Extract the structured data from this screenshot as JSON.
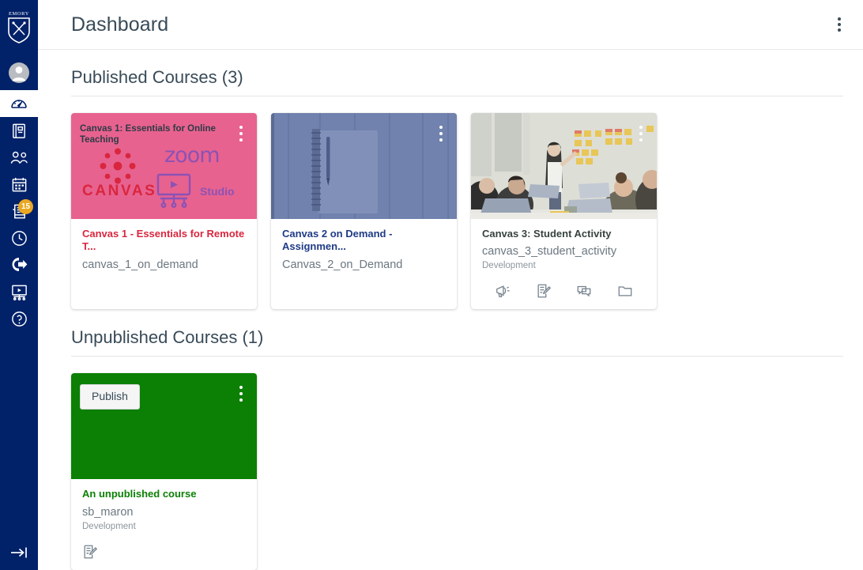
{
  "sidebar": {
    "brand": {
      "name": "EMORY",
      "logo_icon": "emory-shield-logo"
    },
    "items": [
      {
        "key": "account",
        "label": "Account",
        "icon": "user-avatar-icon",
        "active": false,
        "badge": null
      },
      {
        "key": "dashboard",
        "label": "Dashboard",
        "icon": "dashboard-gauge-icon",
        "active": true,
        "badge": null
      },
      {
        "key": "courses",
        "label": "Courses",
        "icon": "book-icon",
        "active": false,
        "badge": null
      },
      {
        "key": "groups",
        "label": "Groups",
        "icon": "people-group-icon",
        "active": false,
        "badge": null
      },
      {
        "key": "calendar",
        "label": "Calendar",
        "icon": "calendar-icon",
        "active": false,
        "badge": null
      },
      {
        "key": "inbox",
        "label": "Inbox",
        "icon": "inbox-tray-icon",
        "active": false,
        "badge": "15"
      },
      {
        "key": "history",
        "label": "History",
        "icon": "clock-icon",
        "active": false,
        "badge": null
      },
      {
        "key": "commons",
        "label": "Commons",
        "icon": "arrow-exit-icon",
        "active": false,
        "badge": null
      },
      {
        "key": "studio",
        "label": "Studio",
        "icon": "studio-screen-icon",
        "active": false,
        "badge": null
      },
      {
        "key": "help",
        "label": "Help",
        "icon": "question-circle-icon",
        "active": false,
        "badge": null
      }
    ],
    "collapse": {
      "label": "Expand navigation",
      "icon": "arrow-to-line-right-icon"
    },
    "background_color": "#012169",
    "badge_color": "#eaa721"
  },
  "header": {
    "title": "Dashboard",
    "options_menu": {
      "label": "Dashboard Options",
      "icon": "kebab-menu-icon"
    }
  },
  "published_section": {
    "title": "Published Courses (3)",
    "count": 3,
    "cards": [
      {
        "id": "canvas-1",
        "title": "Canvas 1 - Essentials for Remote T...",
        "code": "canvas_1_on_demand",
        "term": "",
        "color": "#e8628f",
        "title_color": "#d9263f",
        "kind": "graphic",
        "tile_heading": "Canvas 1: Essentials for Online Teaching",
        "tile_logos": [
          "CANVAS",
          "zoom",
          "Studio"
        ],
        "menu": {
          "label": "Canvas 1 options",
          "icon": "kebab-menu-icon"
        },
        "actions": []
      },
      {
        "id": "canvas-2",
        "title": "Canvas 2 on Demand - Assignmen...",
        "code": "Canvas_2_on_Demand",
        "term": "",
        "color": "#6d7fab",
        "title_color": "#1f3b87",
        "kind": "photo-notebook",
        "menu": {
          "label": "Canvas 2 options",
          "icon": "kebab-menu-icon"
        },
        "actions": []
      },
      {
        "id": "canvas-3",
        "title": "Canvas 3: Student Activity",
        "code": "canvas_3_student_activity",
        "term": "Development",
        "color": "#cfcfc6",
        "title_color": "#37433d",
        "kind": "photo-classroom",
        "menu": {
          "label": "Canvas 3 options",
          "icon": "kebab-menu-icon"
        },
        "actions": [
          {
            "key": "announcements",
            "label": "Announcements",
            "icon": "megaphone-icon"
          },
          {
            "key": "assignments",
            "label": "Assignments",
            "icon": "assignment-edit-icon"
          },
          {
            "key": "discussions",
            "label": "Discussions",
            "icon": "discussion-bubbles-icon"
          },
          {
            "key": "files",
            "label": "Files",
            "icon": "folder-icon"
          }
        ]
      }
    ]
  },
  "unpublished_section": {
    "title": "Unpublished Courses (1)",
    "count": 1,
    "cards": [
      {
        "id": "unpublished-1",
        "title": "An unpublished course",
        "code": "sb_maron",
        "term": "Development",
        "color": "#0b8004",
        "title_color": "#0b8004",
        "kind": "solid",
        "publish_label": "Publish",
        "menu": {
          "label": "An unpublished course options",
          "icon": "kebab-menu-icon"
        },
        "actions": [
          {
            "key": "assignments",
            "label": "Assignments",
            "icon": "assignment-edit-icon"
          }
        ]
      }
    ]
  }
}
